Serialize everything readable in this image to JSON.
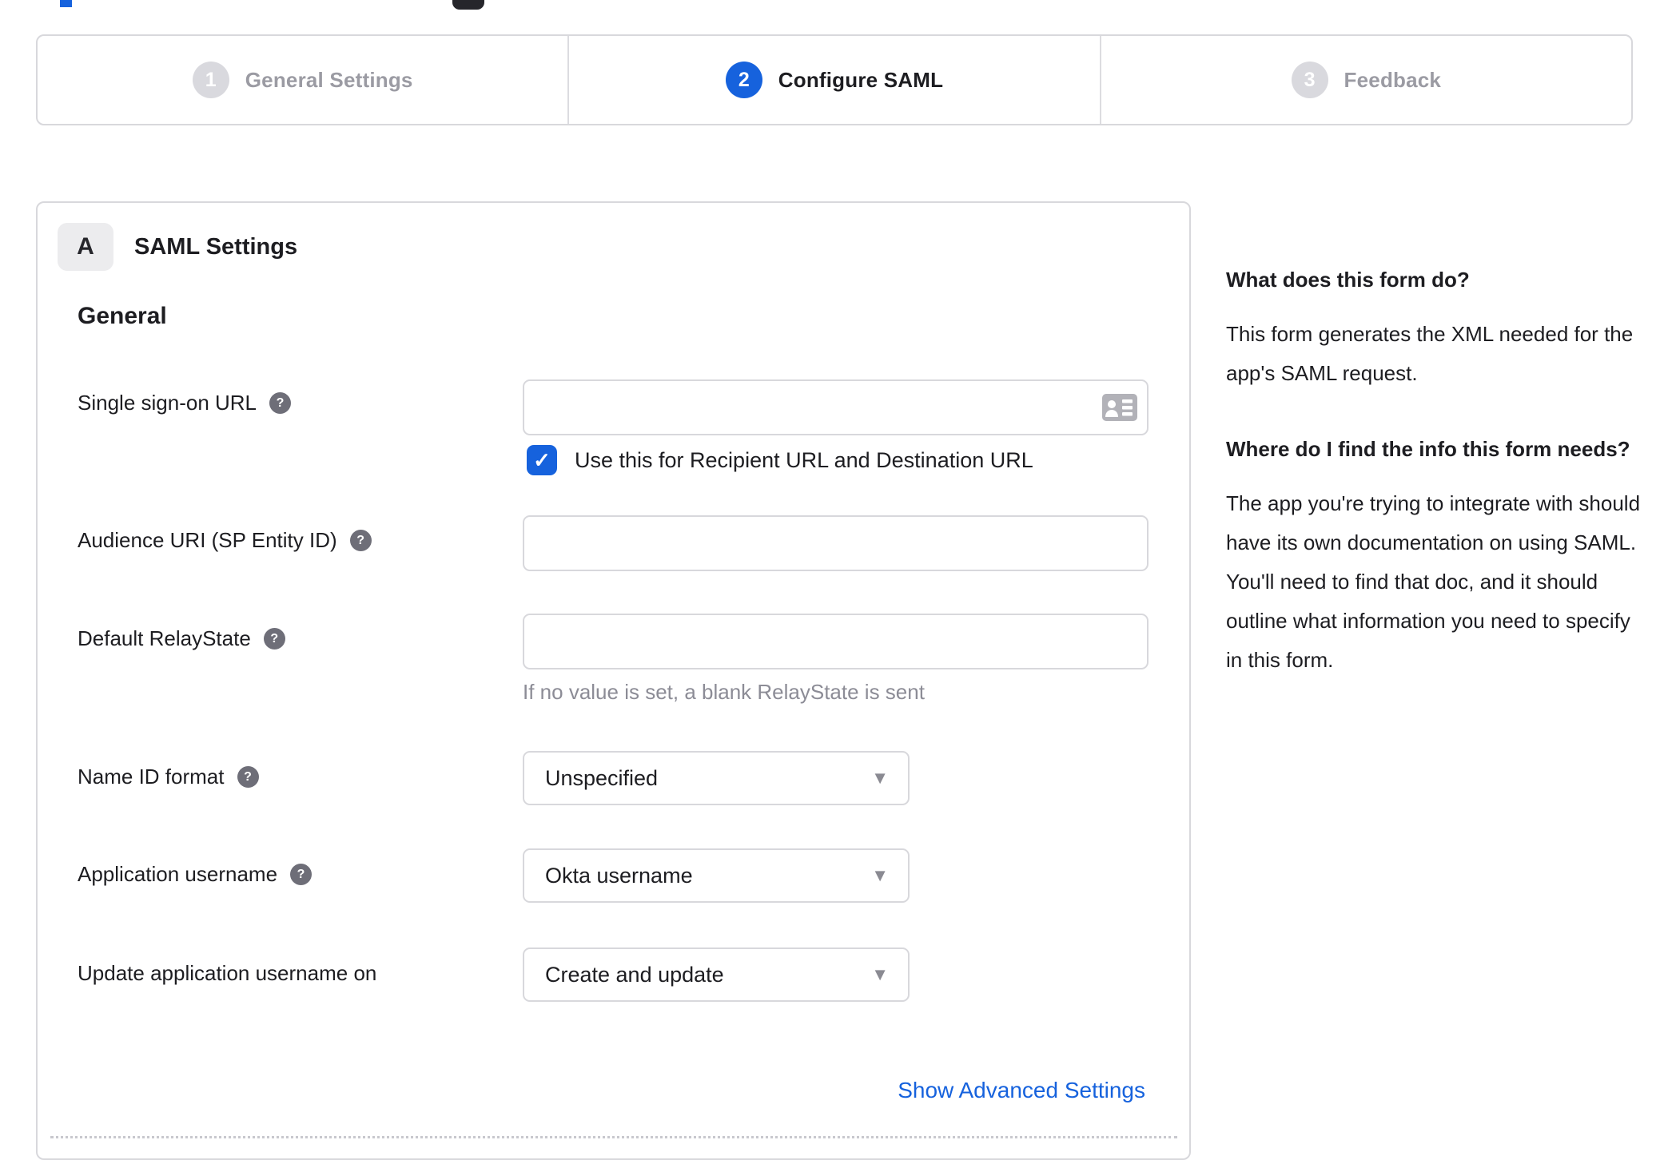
{
  "stepper": {
    "steps": [
      {
        "number": "1",
        "label": "General Settings",
        "state": "inactive"
      },
      {
        "number": "2",
        "label": "Configure SAML",
        "state": "active"
      },
      {
        "number": "3",
        "label": "Feedback",
        "state": "inactive"
      }
    ]
  },
  "panel": {
    "badge": "A",
    "title": "SAML Settings",
    "section": "General",
    "fields": {
      "sso": {
        "label": "Single sign-on URL",
        "value": "",
        "checkbox_label": "Use this for Recipient URL and Destination URL",
        "checkbox_checked": true
      },
      "audience": {
        "label": "Audience URI (SP Entity ID)",
        "value": ""
      },
      "relay": {
        "label": "Default RelayState",
        "value": "",
        "hint": "If no value is set, a blank RelayState is sent"
      },
      "nameid": {
        "label": "Name ID format",
        "value": "Unspecified"
      },
      "appuser": {
        "label": "Application username",
        "value": "Okta username"
      },
      "updateuser": {
        "label": "Update application username on",
        "value": "Create and update"
      }
    },
    "advanced_link": "Show Advanced Settings"
  },
  "sidebar": {
    "sections": [
      {
        "heading": "What does this form do?",
        "body": "This form generates the XML needed for the app's SAML request."
      },
      {
        "heading": "Where do I find the info this form needs?",
        "body": "The app you're trying to integrate with should have its own documentation on using SAML. You'll need to find that doc, and it should outline what information you need to specify in this form."
      }
    ]
  },
  "icons": {
    "check": "✓",
    "help": "?",
    "caret": "▼"
  },
  "colors": {
    "accent_blue": "#1662dd",
    "border_gray": "#d8d8dc",
    "text_dark": "#1d1d21",
    "text_muted": "#8c8c96",
    "step_inactive_circle": "#d9d9de",
    "help_icon_bg": "#6e6e78"
  }
}
